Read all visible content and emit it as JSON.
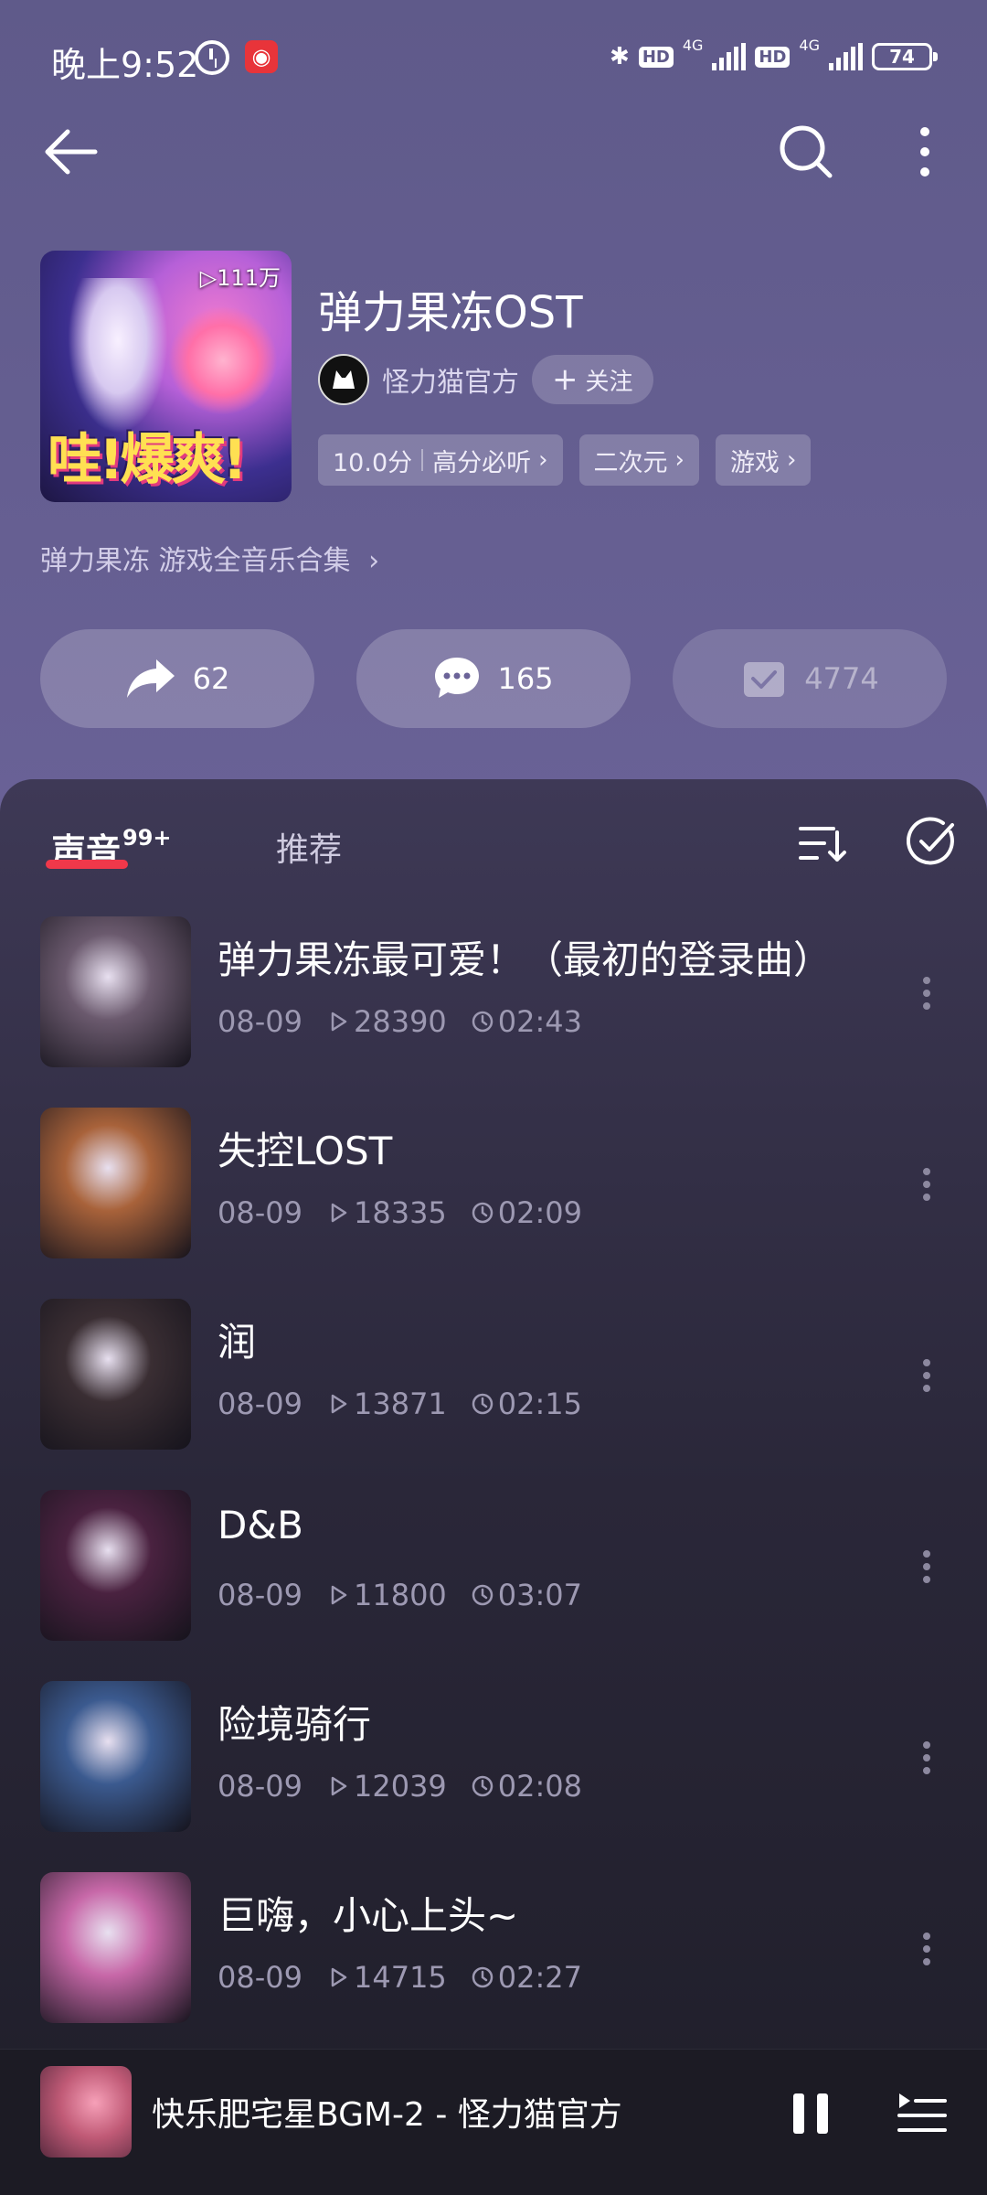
{
  "status_bar": {
    "time": "晚上9:52",
    "network1": "HD",
    "network_type1": "4G",
    "network2": "HD",
    "network_type2": "4G",
    "battery": "74"
  },
  "album": {
    "cover_play_count": "▷111万",
    "cover_text": "哇!爆爽!",
    "title": "弹力果冻OST",
    "author": "怪力猫官方",
    "follow_label": "关注",
    "score": "10.0分",
    "score_tag": "高分必听",
    "tags": [
      "二次元",
      "游戏"
    ],
    "description": "弹力果冻 游戏全音乐合集"
  },
  "actions": {
    "share_count": "62",
    "comment_count": "165",
    "collect_count": "4774"
  },
  "tabs": {
    "sound_label": "声音",
    "sound_badge": "99+",
    "recommend_label": "推荐"
  },
  "tracks": [
    {
      "title": "弹力果冻最可爱！（最初的登录曲）",
      "date": "08-09",
      "plays": "28390",
      "duration": "02:43",
      "thumb_color": "#6b5a6e"
    },
    {
      "title": "失控LOST",
      "date": "08-09",
      "plays": "18335",
      "duration": "02:09",
      "thumb_color": "#a8623a"
    },
    {
      "title": "润",
      "date": "08-09",
      "plays": "13871",
      "duration": "02:15",
      "thumb_color": "#3a2e33"
    },
    {
      "title": "D&B",
      "date": "08-09",
      "plays": "11800",
      "duration": "03:07",
      "thumb_color": "#4a2240"
    },
    {
      "title": "险境骑行",
      "date": "08-09",
      "plays": "12039",
      "duration": "02:08",
      "thumb_color": "#3b5a8f"
    },
    {
      "title": "巨嗨，小心上头~",
      "date": "08-09",
      "plays": "14715",
      "duration": "02:27",
      "thumb_color": "#c768a8"
    }
  ],
  "player": {
    "now_playing": "快乐肥宅星BGM-2 - 怪力猫官方"
  }
}
